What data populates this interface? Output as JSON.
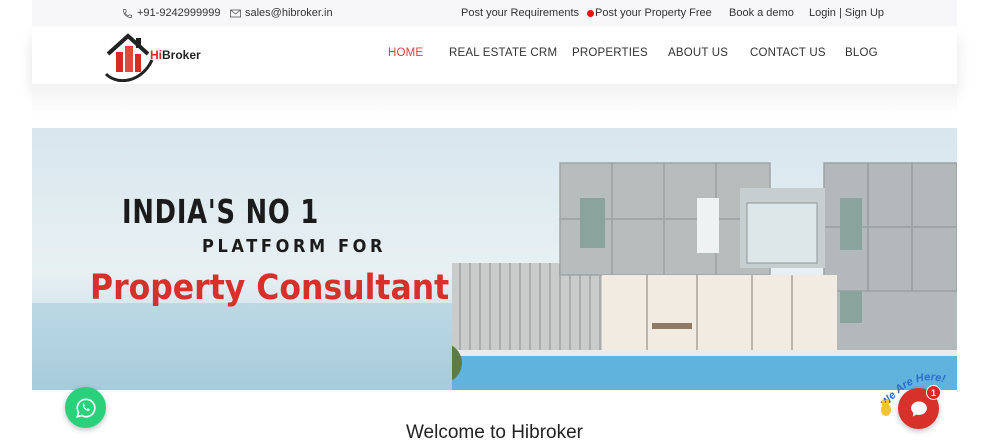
{
  "topbar": {
    "phone": "+91-9242999999",
    "email": "sales@hibroker.in",
    "post_requirements": "Post your Requirements",
    "post_property": "Post your Property Free",
    "book_demo": "Book a demo",
    "login_signup": "Login | Sign Up"
  },
  "brand": {
    "logo_hi": "Hi",
    "logo_rest": "Broker"
  },
  "nav": {
    "items": [
      "HOME",
      "REAL ESTATE CRM",
      "PROPERTIES",
      "ABOUT US",
      "CONTACT US",
      "BLOG"
    ],
    "active": "HOME"
  },
  "hero": {
    "line1": "INDIA'S NO 1",
    "line2": "PLATFORM FOR",
    "line3": "Property Consultant"
  },
  "welcome": "Welcome to Hibroker",
  "chat_widget": {
    "tagline": "We Are Here!",
    "badge_count": "1"
  },
  "colors": {
    "accent_red": "#d7302b",
    "whatsapp_green": "#2bd07a",
    "nav_active": "#d9443a"
  },
  "icons": [
    "phone-icon",
    "email-icon",
    "whatsapp-icon",
    "chat-icon"
  ]
}
